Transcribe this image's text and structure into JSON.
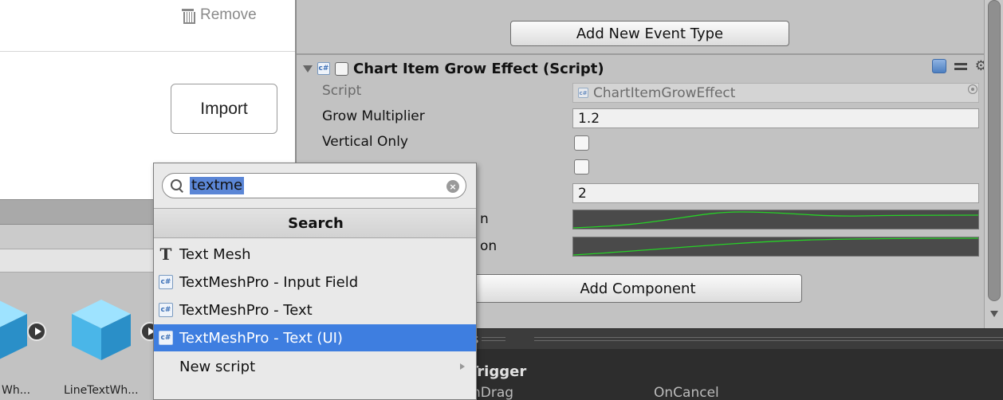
{
  "import_panel": {
    "remove_label": "Remove",
    "import_label": "Import"
  },
  "assets": [
    {
      "label": "Wh..."
    },
    {
      "label": "LineTextWh..."
    }
  ],
  "inspector": {
    "add_event_label": "Add New Event Type",
    "component": {
      "script_badge": "c#",
      "title": "Chart Item Grow Effect (Script)"
    },
    "properties": {
      "script_label": "Script",
      "script_value": "ChartItemGrowEffect",
      "grow_multiplier_label": "Grow Multiplier",
      "grow_multiplier_value": "1.2",
      "vertical_only_label": "Vertical Only",
      "horizontal_only_value_hidden": "",
      "duration_value": "2",
      "curve1_label_tail": "n",
      "curve2_label_tail": "on"
    },
    "add_component_label": "Add Component"
  },
  "bottom_panel": {
    "tab_title": "s",
    "section_title": "Trigger",
    "left_event": "nDrag",
    "right_event": "OnCancel"
  },
  "search_popup": {
    "query": "textme",
    "clear_glyph": "×",
    "header": "Search",
    "items": [
      {
        "label": "Text Mesh",
        "icon": "text-mesh-icon"
      },
      {
        "label": "TextMeshPro - Input Field",
        "icon": "csharp-script-icon"
      },
      {
        "label": "TextMeshPro - Text",
        "icon": "csharp-script-icon"
      },
      {
        "label": "TextMeshPro - Text (UI)",
        "icon": "csharp-script-icon",
        "selected": true
      },
      {
        "label": "New script",
        "icon": "submenu-arrow-icon"
      }
    ]
  },
  "colors": {
    "selection": "#3e7ee0",
    "curve_line": "#27d127",
    "inspector_bg": "#c2c2c2",
    "dark_panel": "#2d2d2d"
  }
}
